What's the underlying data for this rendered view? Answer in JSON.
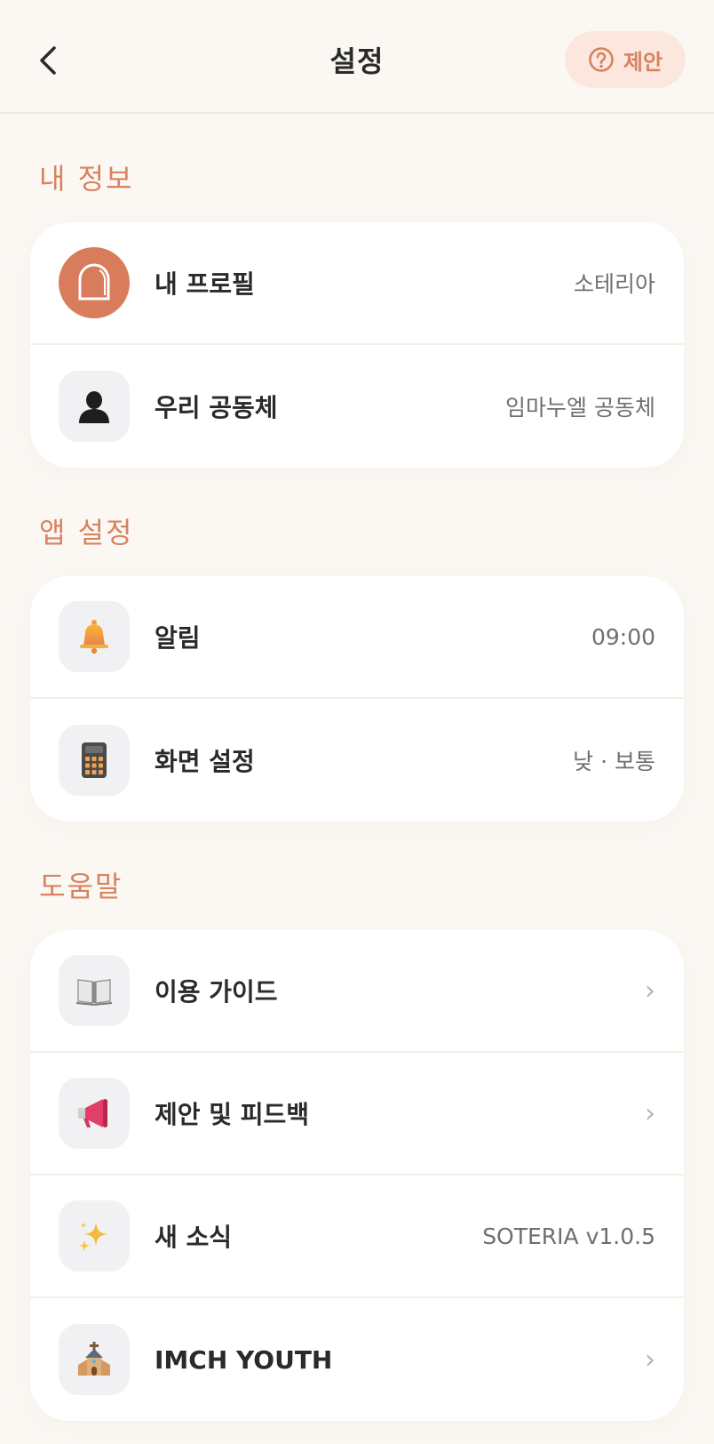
{
  "header": {
    "title": "설정",
    "suggest_label": "제안"
  },
  "sections": {
    "my_info": {
      "title": "내 정보",
      "items": [
        {
          "label": "내 프로필",
          "value": "소테리아",
          "icon": "avatar-icon"
        },
        {
          "label": "우리 공동체",
          "value": "임마누엘 공동체",
          "icon": "person-silhouette-icon"
        }
      ]
    },
    "app_settings": {
      "title": "앱 설정",
      "items": [
        {
          "label": "알림",
          "value": "09:00",
          "icon": "bell-icon"
        },
        {
          "label": "화면 설정",
          "value": "낮 · 보통",
          "icon": "calculator-icon"
        }
      ]
    },
    "help": {
      "title": "도움말",
      "items": [
        {
          "label": "이용 가이드",
          "value": "›",
          "icon": "open-book-icon"
        },
        {
          "label": "제안 및 피드백",
          "value": "›",
          "icon": "megaphone-icon"
        },
        {
          "label": "새 소식",
          "value": "SOTERIA v1.0.5",
          "icon": "sparkles-icon"
        },
        {
          "label": "IMCH YOUTH",
          "value": "›",
          "icon": "church-icon"
        }
      ]
    }
  },
  "colors": {
    "accent": "#d9825f",
    "background": "#fbf8f4",
    "card": "#ffffff"
  }
}
